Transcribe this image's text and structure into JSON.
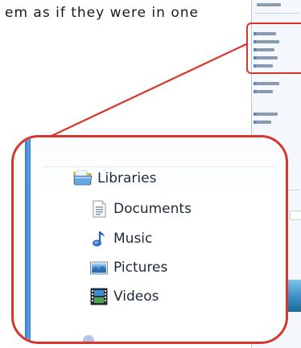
{
  "intro": {
    "text": "em as if they were in one"
  },
  "callout": {
    "nav_items": [
      {
        "label": "Libraries",
        "icon": "libraries-folder-icon"
      },
      {
        "label": "Documents",
        "icon": "documents-icon"
      },
      {
        "label": "Music",
        "icon": "music-note-icon"
      },
      {
        "label": "Pictures",
        "icon": "pictures-icon"
      },
      {
        "label": "Videos",
        "icon": "videos-film-icon"
      }
    ]
  },
  "colors": {
    "highlight_red": "#d9362b",
    "nav_bar_blue": "#3b7fcf",
    "text": "#1e2a3a"
  }
}
